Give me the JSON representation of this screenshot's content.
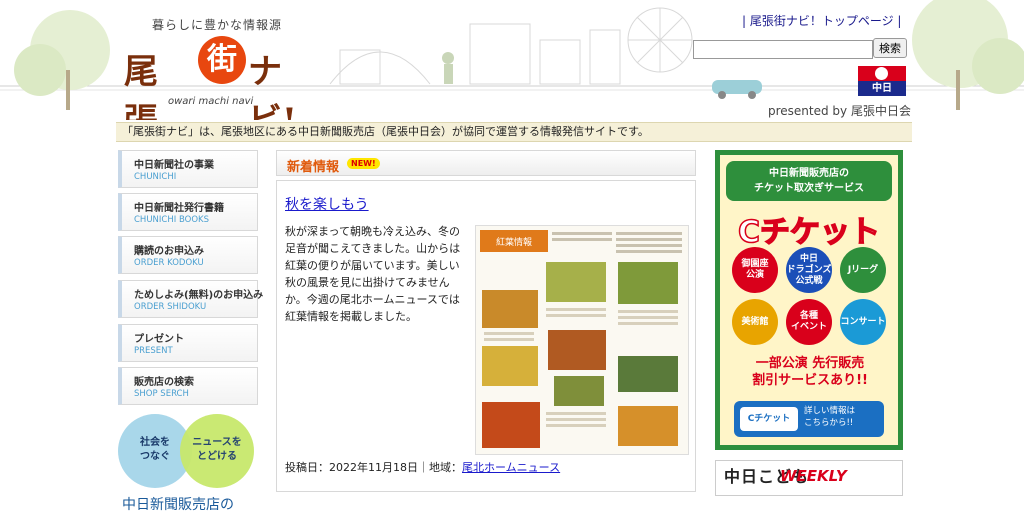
{
  "header": {
    "tagline": "暮らしに豊かな情報源",
    "logo_text_left": "尾張",
    "logo_text_circle": "街",
    "logo_text_right": "ナビ!",
    "logo_romaji": "owari machi navi",
    "top_link": "| 尾張街ナビ！トップページ |",
    "search_placeholder": "",
    "search_button": "検索",
    "chunichi_label": "中日",
    "presented_by": "presented by 尾張中日会"
  },
  "intro": "「尾張街ナビ」は、尾張地区にある中日新聞販売店（尾張中日会）が協同で運営する情報発信サイトです。",
  "sidebar": {
    "items": [
      {
        "jp": "中日新聞社の事業",
        "en": "CHUNICHI"
      },
      {
        "jp": "中日新聞社発行書籍",
        "en": "CHUNICHI BOOKS"
      },
      {
        "jp": "購読のお申込み",
        "en": "ORDER KODOKU"
      },
      {
        "jp": "ためしよみ(無料)のお申込み",
        "en": "ORDER SHIDOKU"
      },
      {
        "jp": "プレゼント",
        "en": "PRESENT"
      },
      {
        "jp": "販売店の検索",
        "en": "SHOP SERCH"
      }
    ],
    "circle_left": "社会を\nつなぐ",
    "circle_right": "ニュースを\nとどける",
    "bottom_cut": "中日新聞販売店の"
  },
  "news": {
    "heading": "新着情報",
    "badge": "NEW!",
    "article_title": "秋を楽しもう",
    "article_body": "秋が深まって朝晩も冷え込み、冬の足音が聞こえてきました。山からは紅葉の便りが届いています。美しい秋の風景を見に出掛けてみませんか。今週の尾北ホームニュースでは紅葉情報を掲載しました。",
    "image_heading": "秋を楽しもう 紅葉情報",
    "posted_label": "投稿日：2022年11月18日｜地域：",
    "region_link": "尾北ホームニュース"
  },
  "ticket_ad": {
    "top": "中日新聞販売店の\nチケット取次ぎサービス",
    "title": "Cチケット",
    "circles": [
      {
        "label": "御園座\n公演",
        "color": "#d9001b"
      },
      {
        "label": "中日\nドラゴンズ\n公式戦",
        "color": "#1b4fb8"
      },
      {
        "label": "Jリーグ",
        "color": "#2e8f3c"
      },
      {
        "label": "美術館",
        "color": "#e8a400"
      },
      {
        "label": "各種\nイベント",
        "color": "#d9001b"
      },
      {
        "label": "コンサート",
        "color": "#1b9ad6"
      }
    ],
    "sale": "一部公演 先行販売\n割引サービスあり!!",
    "bottom_left": "Cチケット",
    "bottom_right": "詳しい情報は\nこちらから!!"
  },
  "weekly_ad": {
    "left": "中日こども",
    "right": "WEEKLY"
  },
  "colors": {
    "accent": "#e05a0c",
    "link": "#1a1acc",
    "ticket_green": "#2e8f3c"
  }
}
